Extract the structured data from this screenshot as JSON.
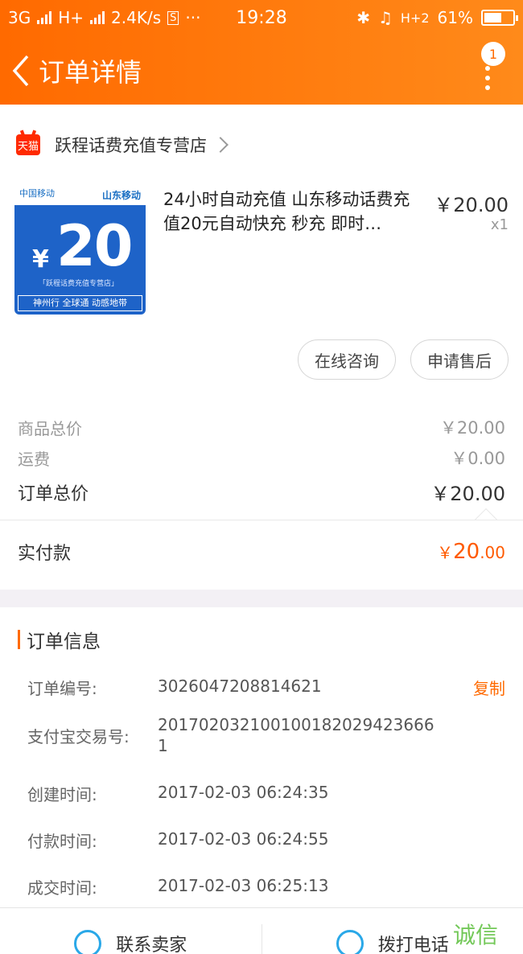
{
  "status_bar": {
    "net1": "3G",
    "net2": "H+",
    "speed": "2.4K/s",
    "time": "19:28",
    "net3": "H+2",
    "battery": "61%",
    "battery_level": 0.61
  },
  "header": {
    "title": "订单详情",
    "badge": "1"
  },
  "shop": {
    "icon_text": "天猫",
    "name": "跃程话费充值专营店"
  },
  "product": {
    "name": "24小时自动充值 山东移动话费充值20元自动快充 秒充 即时…",
    "price": "￥20.00",
    "qty": "x1",
    "thumb": {
      "brand": "中国移动",
      "region": "山东移动",
      "yen": "¥",
      "amount": "20",
      "store": "「跃程话费充值专营店」",
      "slogan": "神州行 全球通 动感地带"
    }
  },
  "actions": {
    "consult": "在线咨询",
    "aftersale": "申请售后"
  },
  "summary": {
    "goods_label": "商品总价",
    "goods_value": "￥20.00",
    "shipping_label": "运费",
    "shipping_value": "￥0.00",
    "total_label": "订单总价",
    "total_value": "￥20.00",
    "paid_label": "实付款",
    "paid_yen": "￥",
    "paid_int": "20",
    "paid_dec": ".00"
  },
  "order_info": {
    "title": "订单信息",
    "rows": [
      {
        "label": "订单编号:",
        "value": "3026047208814621",
        "action": "复制"
      },
      {
        "label": "支付宝交易号:",
        "value": "2017020321001001820294236661"
      },
      {
        "label": "创建时间:",
        "value": "2017-02-03 06:24:35"
      },
      {
        "label": "付款时间:",
        "value": "2017-02-03 06:24:55"
      },
      {
        "label": "成交时间:",
        "value": "2017-02-03 06:25:13"
      }
    ]
  },
  "bottom": {
    "contact_seller": "联系卖家",
    "call": "拨打电话",
    "watermark": "诚信"
  },
  "colors": {
    "accent": "#ff6a00",
    "paid": "#ff5a00",
    "icon_blue": "#2aa8e8"
  }
}
